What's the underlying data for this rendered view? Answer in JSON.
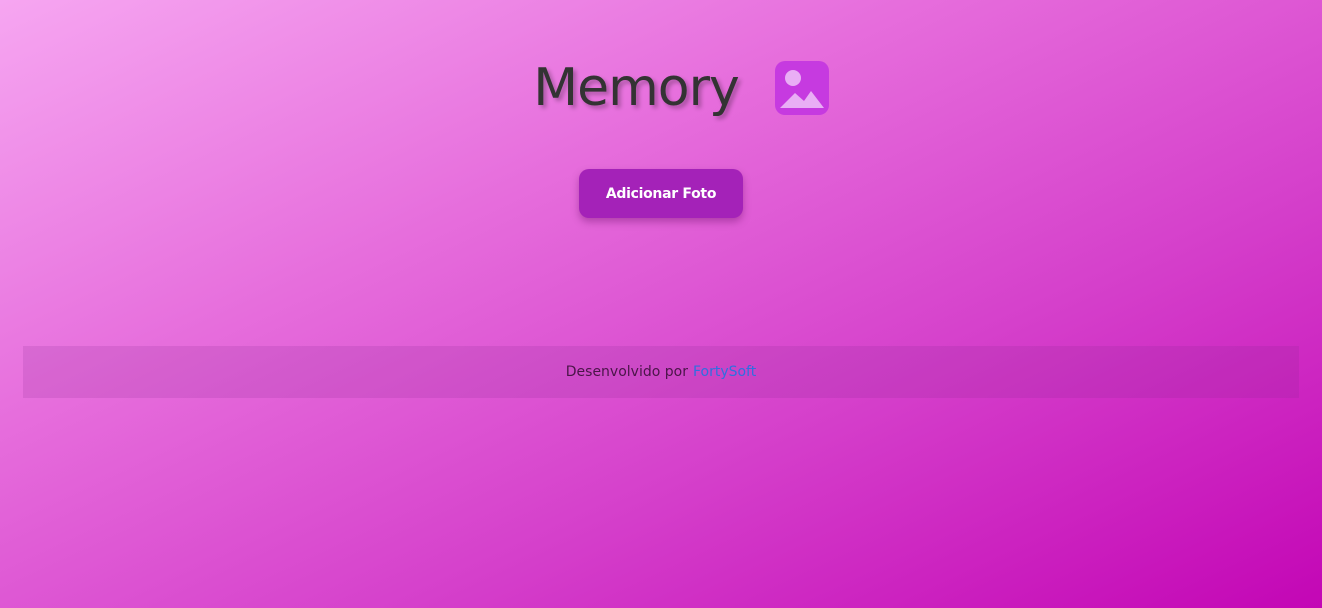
{
  "header": {
    "title": "Memory",
    "icon": "image-icon",
    "icon_color": "#c63ae0"
  },
  "actions": {
    "add_photo_label": "Adicionar Foto",
    "button_color": "#a422b8"
  },
  "footer": {
    "developed_by_text": "Desenvolvido por",
    "company_link_text": "FortySoft",
    "link_color": "#2f6fe0"
  }
}
